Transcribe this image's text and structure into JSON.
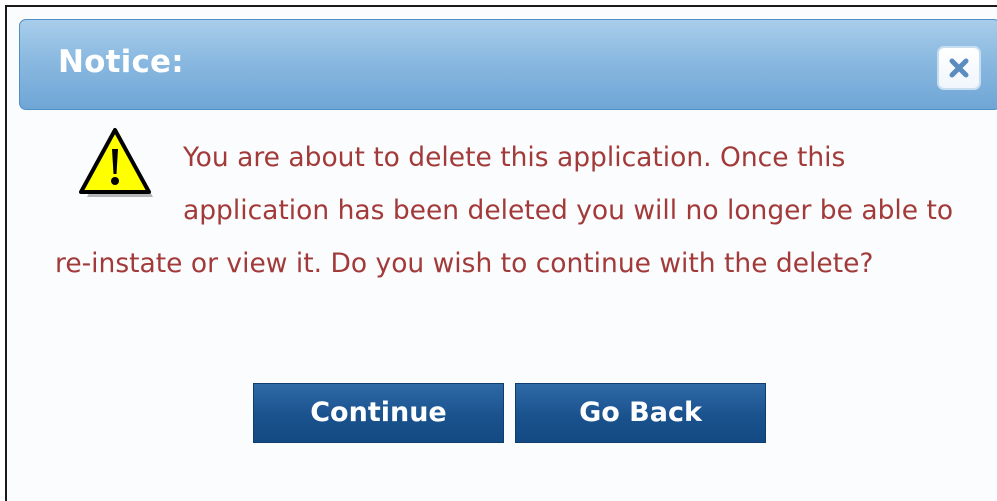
{
  "dialog": {
    "title": "Notice:",
    "close_icon": "close-icon",
    "warning_icon": "warning-icon",
    "message": "You are about to delete this application. Once this application has been deleted you will no longer be able to re-instate or view it. Do you wish to continue with the delete?",
    "buttons": {
      "continue_label": "Continue",
      "go_back_label": "Go Back"
    },
    "colors": {
      "message_text": "#a23a3a",
      "button_bg": "#1a528e",
      "titlebar_bg": "#8ab9e0"
    }
  }
}
